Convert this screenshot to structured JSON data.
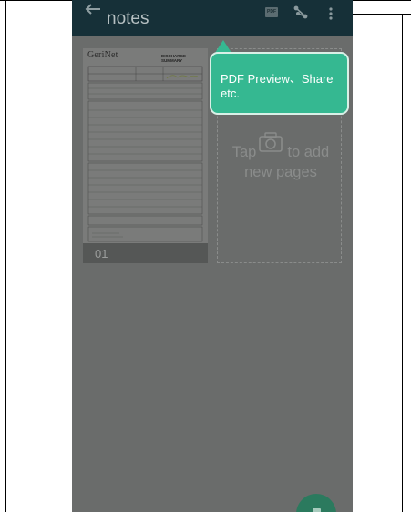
{
  "toolbar": {
    "title": "notes",
    "pdf_label": "PDF",
    "icons": [
      "back-arrow-icon",
      "pdf-icon",
      "share-icon",
      "more-vert-icon"
    ]
  },
  "pages": [
    {
      "number": "01",
      "doc_logo": "GeriNet",
      "doc_heading": "DISCHARGE SUMMARY"
    }
  ],
  "add_page": {
    "line1_a": "Tap",
    "line1_b": "to add",
    "line2": "new pages",
    "icon": "camera-icon"
  },
  "tooltip": {
    "text": "PDF Preview、Share etc."
  },
  "colors": {
    "toolbar": "#163038",
    "overlay_bg": "#6a6c6b",
    "tooltip": "#35b891",
    "fab": "#2b7a5e"
  }
}
